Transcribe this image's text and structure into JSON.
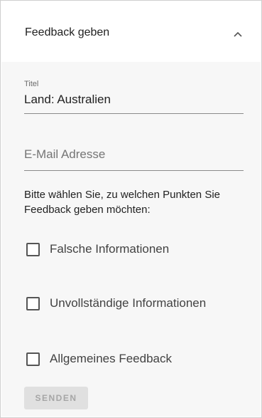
{
  "header": {
    "title": "Feedback geben"
  },
  "form": {
    "title_field": {
      "label": "Titel",
      "value": "Land: Australien"
    },
    "email_field": {
      "placeholder": "E-Mail Adresse",
      "value": ""
    },
    "prompt": "Bitte wählen Sie, zu welchen Punkten Sie Feedback geben möchten:",
    "options": [
      {
        "label": "Falsche Informationen",
        "checked": false
      },
      {
        "label": "Unvollständige Informationen",
        "checked": false
      },
      {
        "label": "Allgemeines Feedback",
        "checked": false
      }
    ],
    "submit_label": "SENDEN"
  },
  "icons": {
    "collapse": "chevron-up-icon"
  },
  "colors": {
    "panel_bg": "#f7f7f7",
    "header_bg": "#ffffff",
    "button_disabled": "#e0e0e0"
  }
}
